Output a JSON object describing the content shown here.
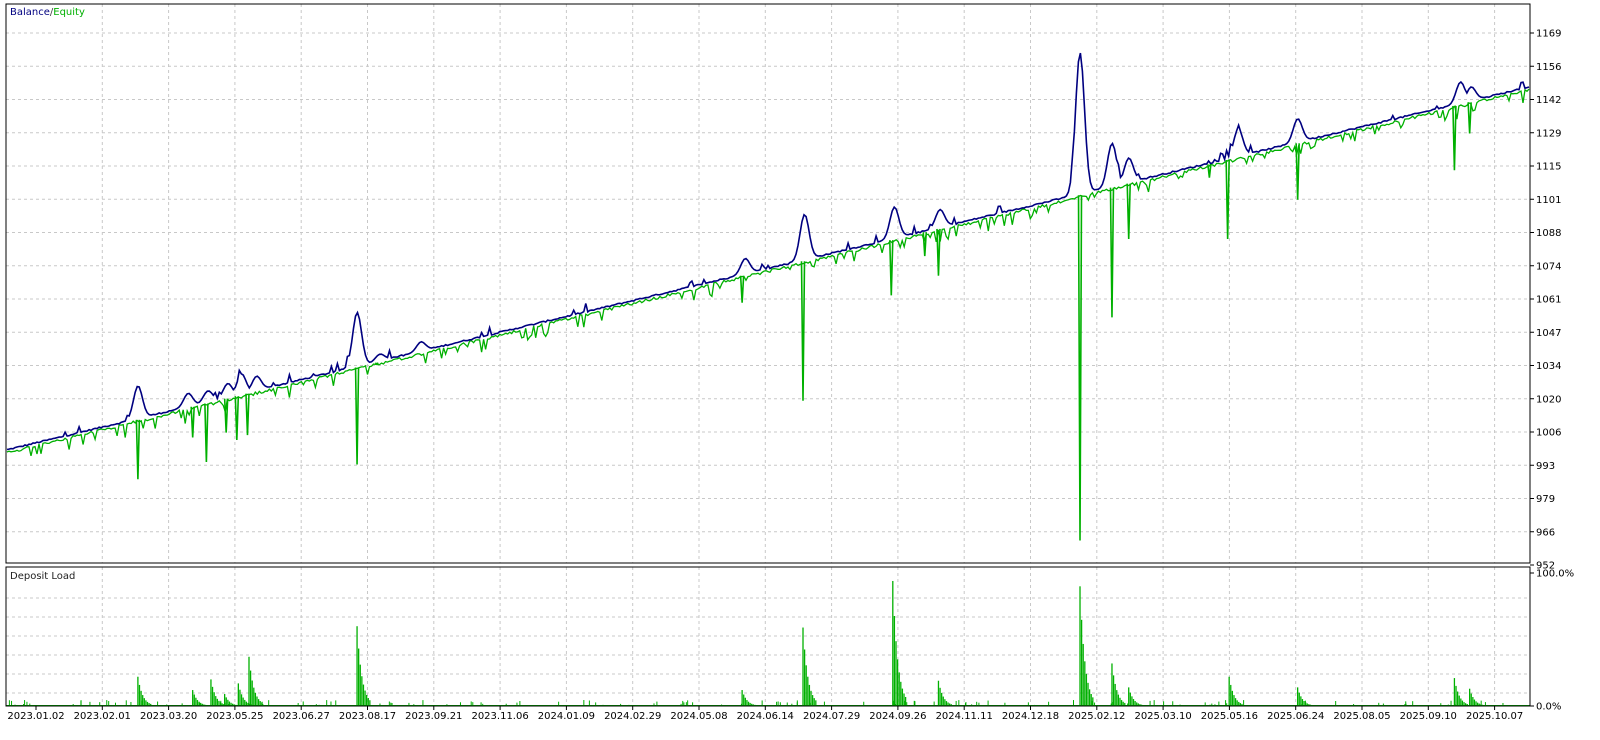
{
  "chart_data": [
    {
      "type": "line",
      "legend": [
        {
          "name": "Balance",
          "color": "#000080"
        },
        {
          "name": "Equity",
          "color": "#00b000"
        }
      ],
      "legend_separator": " / ",
      "legend_placement": "top-left",
      "y_ticks": [
        "1169",
        "1156",
        "1142",
        "1129",
        "1115",
        "1101",
        "1088",
        "1074",
        "1061",
        "1047",
        "1034",
        "1020",
        "1006",
        "993",
        "979",
        "966",
        "952"
      ],
      "ylim": [
        952,
        1169
      ],
      "x_ticks": [
        "2023.01.02",
        "2023.02.01",
        "2023.03.20",
        "2023.05.25",
        "2023.06.27",
        "2023.08.17",
        "2023.09.21",
        "2023.11.06",
        "2024.01.09",
        "2024.02.29",
        "2024.05.08",
        "2024.06.14",
        "2024.07.29",
        "2024.09.26",
        "2024.11.11",
        "2024.12.18",
        "2025.02.12",
        "2025.03.10",
        "2025.05.16",
        "2025.06.24",
        "2025.08.05",
        "2025.09.10",
        "2025.10.07"
      ],
      "grid": true,
      "baseline": {
        "start": 999,
        "end": 1147
      },
      "balance_spikes": [
        {
          "t": 0.086,
          "v": 1025
        },
        {
          "t": 0.119,
          "v": 1022
        },
        {
          "t": 0.132,
          "v": 1023
        },
        {
          "t": 0.145,
          "v": 1026
        },
        {
          "t": 0.154,
          "v": 1030
        },
        {
          "t": 0.164,
          "v": 1029
        },
        {
          "t": 0.23,
          "v": 1055
        },
        {
          "t": 0.245,
          "v": 1038
        },
        {
          "t": 0.272,
          "v": 1043
        },
        {
          "t": 0.485,
          "v": 1077
        },
        {
          "t": 0.524,
          "v": 1095
        },
        {
          "t": 0.583,
          "v": 1098
        },
        {
          "t": 0.613,
          "v": 1097
        },
        {
          "t": 0.705,
          "v": 1161
        },
        {
          "t": 0.726,
          "v": 1124
        },
        {
          "t": 0.737,
          "v": 1118
        },
        {
          "t": 0.809,
          "v": 1130
        },
        {
          "t": 0.848,
          "v": 1134
        },
        {
          "t": 0.955,
          "v": 1149
        },
        {
          "t": 0.962,
          "v": 1147
        }
      ],
      "equity_drops": [
        {
          "t": 0.086,
          "v": 987
        },
        {
          "t": 0.122,
          "v": 1004
        },
        {
          "t": 0.131,
          "v": 994
        },
        {
          "t": 0.144,
          "v": 1006
        },
        {
          "t": 0.151,
          "v": 1003
        },
        {
          "t": 0.158,
          "v": 1005
        },
        {
          "t": 0.23,
          "v": 993
        },
        {
          "t": 0.243,
          "v": 1034
        },
        {
          "t": 0.483,
          "v": 1059
        },
        {
          "t": 0.523,
          "v": 1019
        },
        {
          "t": 0.581,
          "v": 1062
        },
        {
          "t": 0.603,
          "v": 1078
        },
        {
          "t": 0.612,
          "v": 1070
        },
        {
          "t": 0.705,
          "v": 962
        },
        {
          "t": 0.726,
          "v": 1053
        },
        {
          "t": 0.737,
          "v": 1085
        },
        {
          "t": 0.79,
          "v": 1110
        },
        {
          "t": 0.802,
          "v": 1085
        },
        {
          "t": 0.848,
          "v": 1101
        },
        {
          "t": 0.951,
          "v": 1113
        },
        {
          "t": 0.961,
          "v": 1128
        }
      ]
    },
    {
      "type": "bar",
      "title": "Deposit Load",
      "y_ticks": [
        "100.0%",
        "0.0%"
      ],
      "ylim": [
        0,
        100
      ],
      "unit": "%",
      "grid": true,
      "bars": [
        {
          "t": 0.086,
          "v": 22
        },
        {
          "t": 0.122,
          "v": 12
        },
        {
          "t": 0.134,
          "v": 20
        },
        {
          "t": 0.143,
          "v": 9
        },
        {
          "t": 0.152,
          "v": 17
        },
        {
          "t": 0.159,
          "v": 37
        },
        {
          "t": 0.23,
          "v": 60
        },
        {
          "t": 0.483,
          "v": 12
        },
        {
          "t": 0.523,
          "v": 59
        },
        {
          "t": 0.582,
          "v": 94
        },
        {
          "t": 0.612,
          "v": 19
        },
        {
          "t": 0.705,
          "v": 90
        },
        {
          "t": 0.726,
          "v": 32
        },
        {
          "t": 0.737,
          "v": 14
        },
        {
          "t": 0.803,
          "v": 22
        },
        {
          "t": 0.848,
          "v": 14
        },
        {
          "t": 0.951,
          "v": 21
        },
        {
          "t": 0.961,
          "v": 13
        }
      ]
    }
  ]
}
